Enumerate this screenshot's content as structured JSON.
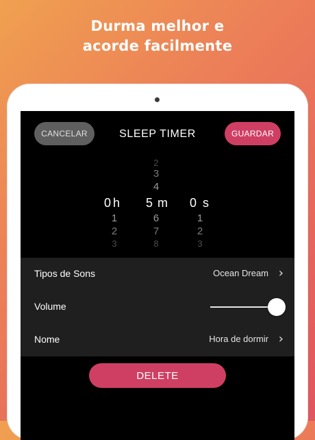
{
  "headline": {
    "line1": "Durma melhor e",
    "line2": "acorde facilmente"
  },
  "colors": {
    "accent": "#cf3f63",
    "cancel_bg": "#5f5f5f",
    "settings_bg": "#1f1f1f"
  },
  "topbar": {
    "cancel_label": "CANCELAR",
    "title": "SLEEP TIMER",
    "save_label": "GUARDAR"
  },
  "picker": {
    "hours": {
      "above": [],
      "selected": "0",
      "below": [
        "1",
        "2",
        "3"
      ],
      "unit": "h"
    },
    "minutes": {
      "above": [
        "2",
        "3",
        "4"
      ],
      "selected": "5",
      "below": [
        "6",
        "7",
        "8"
      ],
      "unit": "m"
    },
    "seconds": {
      "above": [],
      "selected": "0",
      "below": [
        "1",
        "2",
        "3"
      ],
      "unit": "s"
    }
  },
  "settings": {
    "sounds": {
      "label": "Tipos de Sons",
      "value": "Ocean Dream",
      "icon": "chevron-right-icon"
    },
    "volume": {
      "label": "Volume",
      "level": 1.0
    },
    "name": {
      "label": "Nome",
      "value": "Hora de dormir",
      "icon": "chevron-right-icon"
    }
  },
  "delete_label": "DELETE"
}
